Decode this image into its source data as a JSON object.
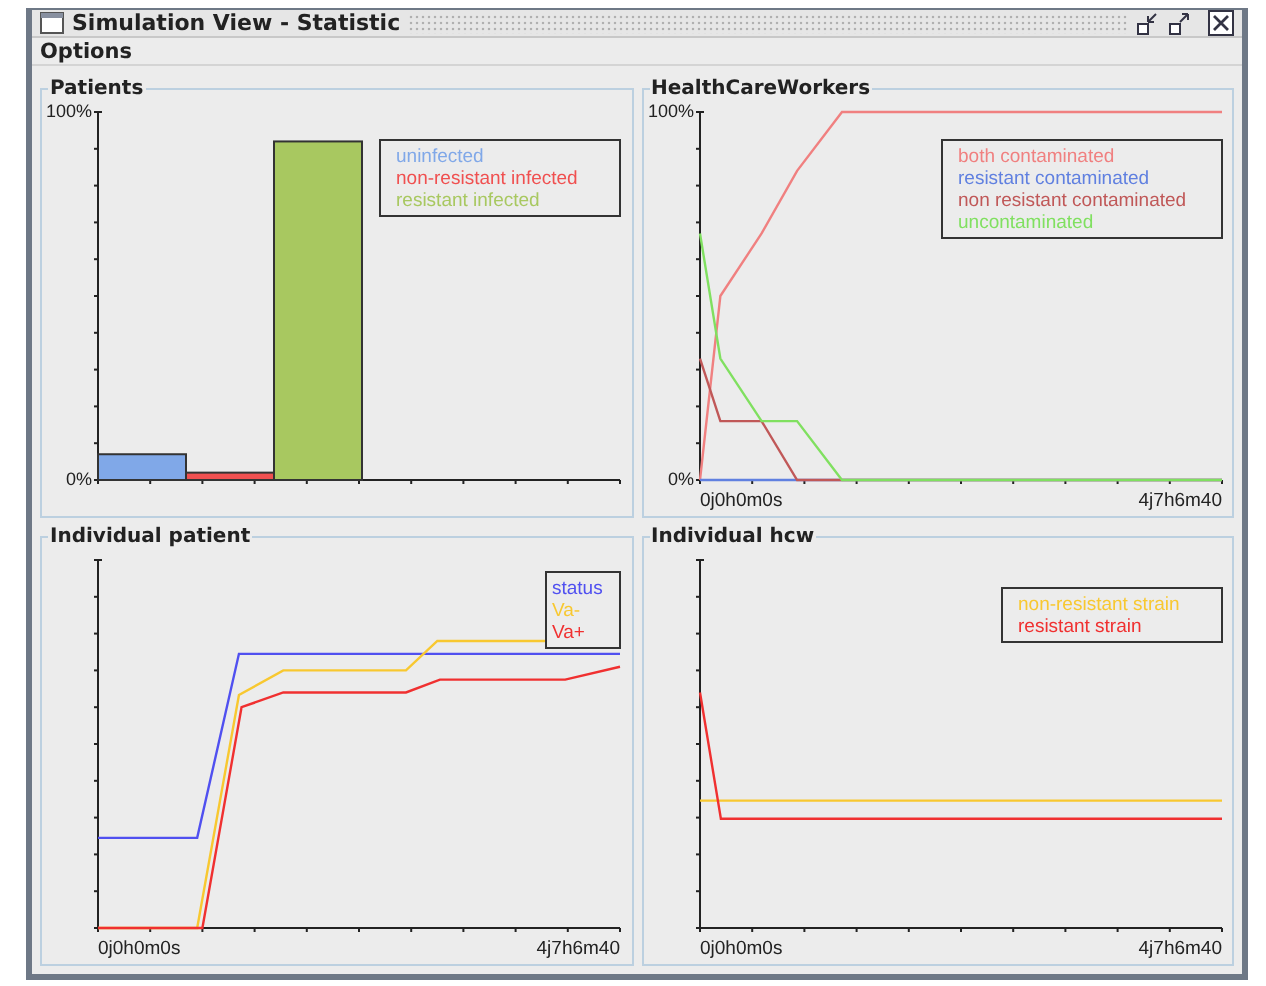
{
  "window": {
    "title": "Simulation View - Statistic"
  },
  "menu": [
    "Options"
  ],
  "panels": [
    {
      "kind": "bar",
      "title": "Patients",
      "chart_data": {
        "type": "bar",
        "yticks": [
          {
            "value": 0,
            "label": "0%"
          },
          {
            "value": 100,
            "label": "100%"
          }
        ],
        "ylim": [
          0,
          100
        ],
        "series": [
          {
            "name": "uninfected",
            "color": "#80a8e8",
            "values": [
              7
            ]
          },
          {
            "name": "non-resistant infected",
            "color": "#f05050",
            "values": [
              2
            ]
          },
          {
            "name": "resistant infected",
            "color": "#a8c860",
            "values": [
              92
            ]
          }
        ]
      }
    },
    {
      "kind": "trace",
      "title": "HealthCareWorkers",
      "ylabels": [
        "100%",
        "0%"
      ],
      "xlabels": [
        "0j0h0m0s",
        "4j7h6m40"
      ],
      "legend": [
        {
          "label": "both contaminated",
          "color": "#f08080"
        },
        {
          "label": "resistant contaminated",
          "color": "#6080e0"
        },
        {
          "label": "non resistant contaminated",
          "color": "#c05858"
        },
        {
          "label": "uncontaminated",
          "color": "#80e060"
        }
      ]
    },
    {
      "kind": "trace",
      "title": "Individual patient",
      "xlabels": [
        "0j0h0m0s",
        "4j7h6m40"
      ],
      "legend": [
        {
          "label": "status",
          "color": "#5050f0"
        },
        {
          "label": "Va-",
          "color": "#f8c830"
        },
        {
          "label": "Va+",
          "color": "#f03030"
        }
      ]
    },
    {
      "kind": "trace",
      "title": "Individual hcw",
      "xlabels": [
        "0j0h0m0s",
        "4j7h6m40"
      ],
      "legend": [
        {
          "label": "non-resistant strain",
          "color": "#f8c830"
        },
        {
          "label": "resistant strain",
          "color": "#f03030"
        }
      ]
    }
  ]
}
